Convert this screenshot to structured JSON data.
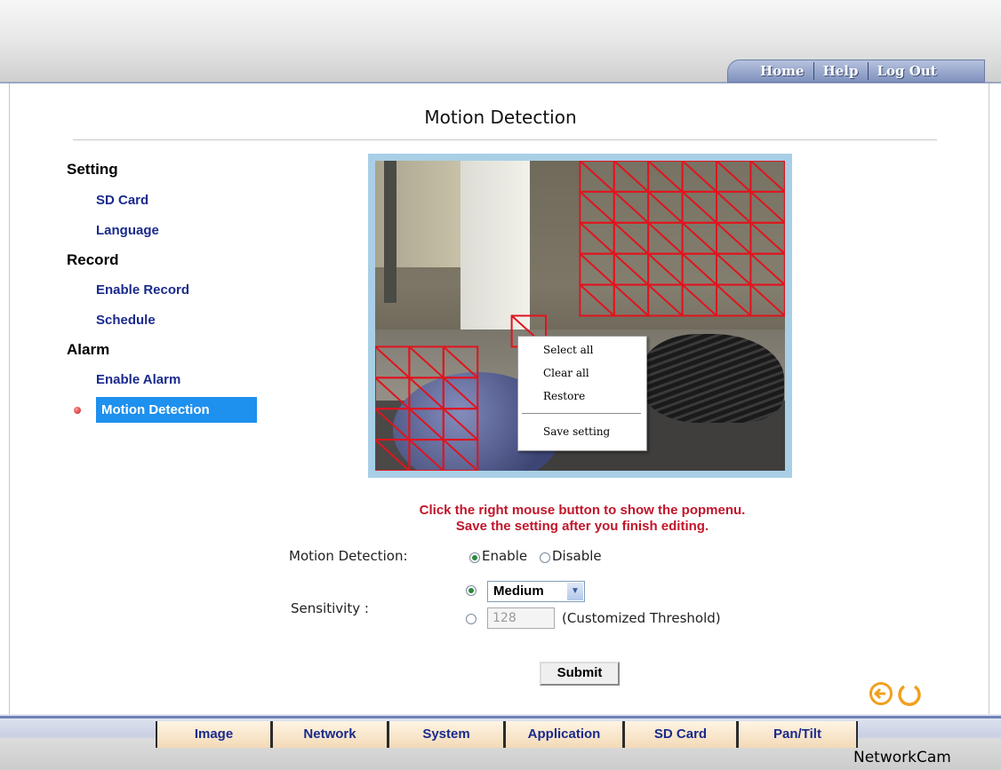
{
  "top_nav": {
    "home": "Home",
    "help": "Help",
    "logout": "Log Out"
  },
  "page_title": "Motion Detection",
  "sidebar": {
    "sections": [
      {
        "heading": "Setting",
        "items": [
          "SD Card",
          "Language"
        ]
      },
      {
        "heading": "Record",
        "items": [
          "Enable Record",
          "Schedule"
        ]
      },
      {
        "heading": "Alarm",
        "items": [
          "Enable Alarm",
          "Motion Detection"
        ]
      }
    ],
    "active_item": "Motion Detection"
  },
  "popup_menu": {
    "select_all": "Select all",
    "clear_all": "Clear all",
    "restore": "Restore",
    "save_setting": "Save setting"
  },
  "instructions": {
    "line1": "Click the right mouse button to show the popmenu.",
    "line2": "Save the setting after you finish editing."
  },
  "form": {
    "motion_label": "Motion Detection:",
    "enable_label": "Enable",
    "disable_label": "Disable",
    "motion_selected": "Enable",
    "sensitivity_label": "Sensitivity :",
    "sensitivity_value": "Medium",
    "threshold_value": "128",
    "threshold_label": "(Customized Threshold)",
    "submit_label": "Submit"
  },
  "bottom_tabs": [
    "Image",
    "Network",
    "System",
    "Application",
    "SD Card",
    "Pan/Tilt"
  ],
  "brand": "NetworkCam",
  "colors": {
    "active_highlight": "#1e90ee",
    "instruction_text": "#c2152a",
    "grid_lines": "#e0141e",
    "link_text": "#1a2a8c",
    "icon_orange": "#f0a020"
  },
  "icons": {
    "back": "back-arrow-icon",
    "refresh": "refresh-icon",
    "bullet": "active-bullet-icon"
  }
}
